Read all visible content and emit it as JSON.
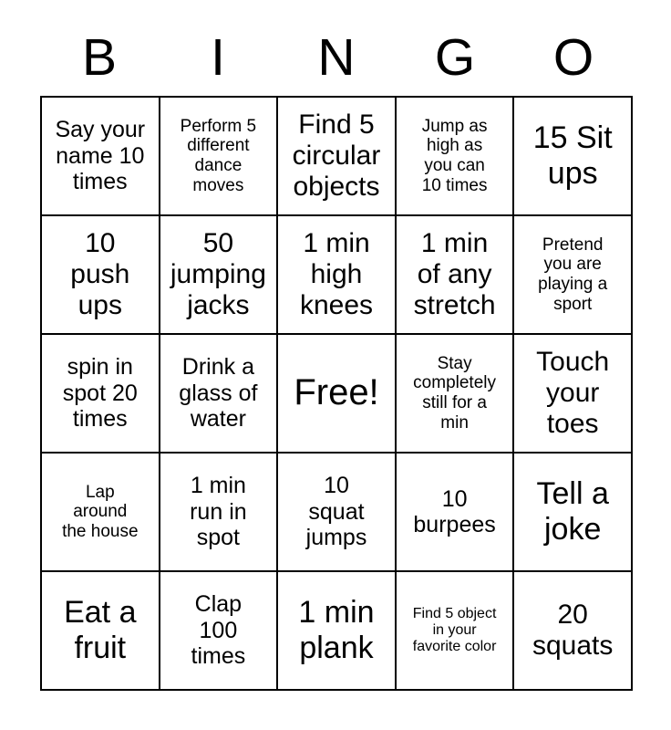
{
  "card": {
    "header_letters": [
      "B",
      "I",
      "N",
      "G",
      "O"
    ],
    "colors": {
      "background": "#ffffff",
      "text": "#000000",
      "grid_line": "#000000"
    },
    "grid": {
      "columns": 5,
      "rows": 5,
      "free_space_index": 12
    },
    "cells": [
      {
        "text": "Say your\nname 10\ntimes",
        "size": "md"
      },
      {
        "text": "Perform 5\ndifferent\ndance\nmoves",
        "size": "sm"
      },
      {
        "text": "Find 5\ncircular\nobjects",
        "size": "lg"
      },
      {
        "text": "Jump as\nhigh as\nyou can\n10 times",
        "size": "sm"
      },
      {
        "text": "15 Sit\nups",
        "size": "xl"
      },
      {
        "text": "10\npush\nups",
        "size": "lg"
      },
      {
        "text": "50\njumping\njacks",
        "size": "lg"
      },
      {
        "text": "1 min\nhigh\nknees",
        "size": "lg"
      },
      {
        "text": "1 min\nof any\nstretch",
        "size": "lg"
      },
      {
        "text": "Pretend\nyou are\nplaying a\nsport",
        "size": "sm"
      },
      {
        "text": "spin in\nspot 20\ntimes",
        "size": "md"
      },
      {
        "text": "Drink a\nglass of\nwater",
        "size": "md"
      },
      {
        "text": "Free!",
        "size": "xxl"
      },
      {
        "text": "Stay\ncompletely\nstill for a\nmin",
        "size": "sm"
      },
      {
        "text": "Touch\nyour\ntoes",
        "size": "lg"
      },
      {
        "text": "Lap\naround\nthe house",
        "size": "sm"
      },
      {
        "text": "1 min\nrun in\nspot",
        "size": "md"
      },
      {
        "text": "10\nsquat\njumps",
        "size": "md"
      },
      {
        "text": "10\nburpees",
        "size": "md"
      },
      {
        "text": "Tell a\njoke",
        "size": "xl"
      },
      {
        "text": "Eat a\nfruit",
        "size": "xl"
      },
      {
        "text": "Clap\n100\ntimes",
        "size": "md"
      },
      {
        "text": "1 min\nplank",
        "size": "xl"
      },
      {
        "text": "Find 5 object\nin your\nfavorite color",
        "size": "xs"
      },
      {
        "text": "20\nsquats",
        "size": "lg"
      }
    ]
  }
}
